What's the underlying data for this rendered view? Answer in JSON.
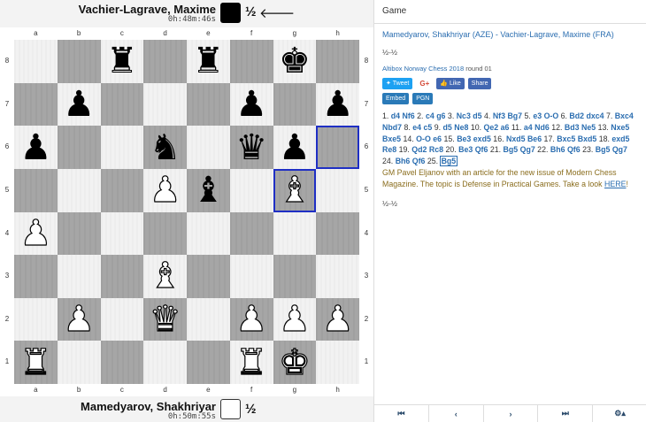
{
  "black_player": {
    "name": "Vachier-Lagrave, Maxime",
    "clock": "0h:48m:46s",
    "result": "½",
    "turn_arrow": "🡐"
  },
  "white_player": {
    "name": "Mamedyarov, Shakhriyar",
    "clock": "0h:50m:55s",
    "result": "½"
  },
  "files": [
    "a",
    "b",
    "c",
    "d",
    "e",
    "f",
    "g",
    "h"
  ],
  "ranks": [
    "8",
    "7",
    "6",
    "5",
    "4",
    "3",
    "2",
    "1"
  ],
  "board": [
    [
      "",
      "",
      "bR",
      "",
      "bR",
      "",
      "bK",
      ""
    ],
    [
      "",
      "bP",
      "",
      "",
      "",
      "bP",
      "",
      "bP"
    ],
    [
      "bP",
      "",
      "",
      "bN",
      "",
      "bQ",
      "bP",
      ""
    ],
    [
      "",
      "",
      "",
      "wP",
      "bB",
      "",
      "wB",
      ""
    ],
    [
      "wP",
      "",
      "",
      "",
      "",
      "",
      "",
      ""
    ],
    [
      "",
      "",
      "",
      "wB",
      "",
      "",
      "",
      ""
    ],
    [
      "",
      "wP",
      "",
      "wQ",
      "",
      "wP",
      "wP",
      "wP"
    ],
    [
      "wR",
      "",
      "",
      "",
      "",
      "wR",
      "wK",
      ""
    ]
  ],
  "highlighted_squares": [
    "h6",
    "g5"
  ],
  "panel": {
    "header": "Game",
    "title": "Mamedyarov, Shakhriyar (AZE) - Vachier-Lagrave, Maxime (FRA)",
    "result": "½-½",
    "event": "Altibox Norway Chess 2018",
    "round": " round 01",
    "buttons": {
      "tweet": "Tweet",
      "gplus": "G+",
      "like": "Like",
      "share": "Share",
      "embed": "Embed",
      "pgn": "PGN"
    },
    "moves": [
      {
        "n": "1.",
        "w": "d4",
        "b": "Nf6"
      },
      {
        "n": "2.",
        "w": "c4",
        "b": "g6"
      },
      {
        "n": "3.",
        "w": "Nc3",
        "b": "d5"
      },
      {
        "n": "4.",
        "w": "Nf3",
        "b": "Bg7"
      },
      {
        "n": "5.",
        "w": "e3",
        "b": "O-O"
      },
      {
        "n": "6.",
        "w": "Bd2",
        "b": "dxc4"
      },
      {
        "n": "7.",
        "w": "Bxc4",
        "b": "Nbd7"
      },
      {
        "n": "8.",
        "w": "e4",
        "b": "c5"
      },
      {
        "n": "9.",
        "w": "d5",
        "b": "Ne8"
      },
      {
        "n": "10.",
        "w": "Qe2",
        "b": "a6"
      },
      {
        "n": "11.",
        "w": "a4",
        "b": "Nd6"
      },
      {
        "n": "12.",
        "w": "Bd3",
        "b": "Ne5"
      },
      {
        "n": "13.",
        "w": "Nxe5",
        "b": "Bxe5"
      },
      {
        "n": "14.",
        "w": "O-O",
        "b": "e6"
      },
      {
        "n": "15.",
        "w": "Be3",
        "b": "exd5"
      },
      {
        "n": "16.",
        "w": "Nxd5",
        "b": "Be6"
      },
      {
        "n": "17.",
        "w": "Bxc5",
        "b": "Bxd5"
      },
      {
        "n": "18.",
        "w": "exd5",
        "b": "Re8"
      },
      {
        "n": "19.",
        "w": "Qd2",
        "b": "Rc8"
      },
      {
        "n": "20.",
        "w": "Be3",
        "b": "Qf6"
      },
      {
        "n": "21.",
        "w": "Bg5",
        "b": "Qg7"
      },
      {
        "n": "22.",
        "w": "Bh6",
        "b": "Qf6"
      },
      {
        "n": "23.",
        "w": "Bg5",
        "b": "Qg7"
      },
      {
        "n": "24.",
        "w": "Bh6",
        "b": "Qf6"
      },
      {
        "n": "25.",
        "w": "Bg5",
        "b": ""
      }
    ],
    "comment": "GM Pavel Eljanov with an article for the new issue of Modern Chess Magazine. The topic is Defense in Practical Games. Take a look ",
    "comment_link": "HERE",
    "comment_end": "!",
    "final_result": "½-½"
  },
  "nav": {
    "first": "⏮",
    "prev": "‹",
    "next": "›",
    "last": "⏭",
    "settings": "⚙▴"
  }
}
